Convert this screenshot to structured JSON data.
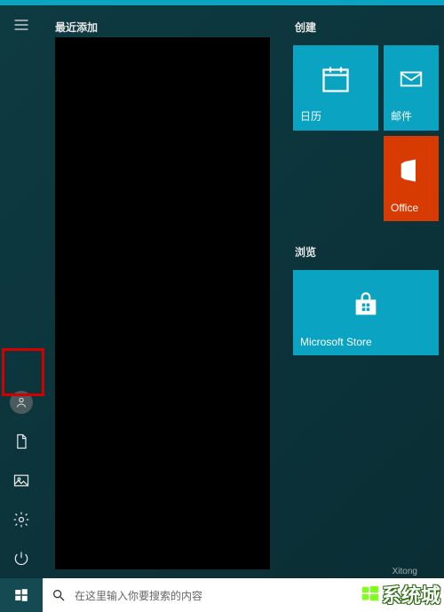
{
  "start_menu": {
    "apps_heading": "最近添加",
    "rail": {
      "expand": "展开",
      "user": "用户",
      "documents": "文档",
      "pictures": "图片",
      "settings": "设置",
      "power": "电源"
    },
    "groups": [
      {
        "heading": "创建",
        "tiles": [
          {
            "id": "calendar",
            "label": "日历",
            "icon": "calendar-icon",
            "color": "#0aa3c2"
          },
          {
            "id": "mail",
            "label": "邮件",
            "icon": "mail-icon",
            "color": "#0aa3c2"
          },
          {
            "id": "office",
            "label": "Office",
            "icon": "office-icon",
            "color": "#d83b01"
          }
        ]
      },
      {
        "heading": "浏览",
        "tiles": [
          {
            "id": "store",
            "label": "Microsoft Store",
            "icon": "store-icon",
            "color": "#0aa3c2"
          }
        ]
      }
    ]
  },
  "taskbar": {
    "search_placeholder": "在这里输入你要搜索的内容"
  },
  "watermark": {
    "text": "系统城",
    "sub": "Xitong"
  }
}
